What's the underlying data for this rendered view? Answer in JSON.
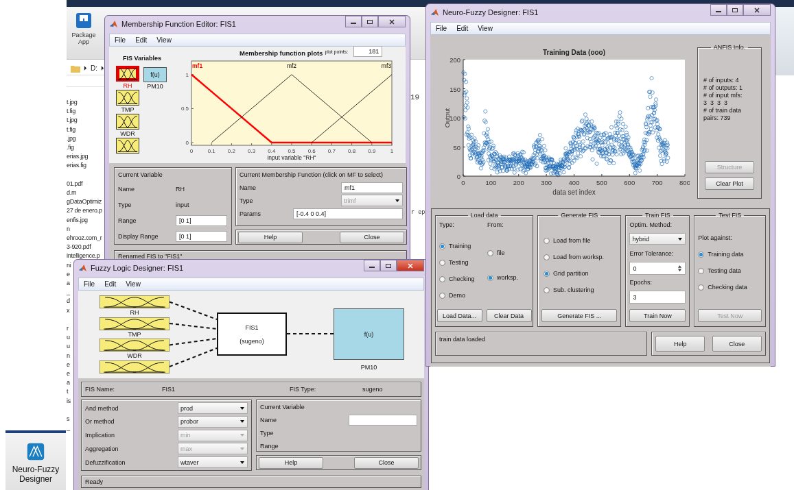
{
  "desktop": {
    "ribbon_button": "Package App",
    "path": "D:",
    "file_groups": [
      [
        "t.jpg",
        "t.fig",
        "t.jpg",
        "t.fig",
        ".jpg",
        ".fig",
        "erias.jpg",
        "erias.fig"
      ],
      [
        "01.pdf",
        "d.m",
        "gDataOptimiz",
        "27 de enero.p",
        "enfis.jpg",
        "n",
        "ehrooz.com_r",
        "3-920.pdf",
        "intelligence.p",
        "ni",
        "e",
        "a",
        "_",
        "d",
        "x"
      ],
      [
        "r",
        "u",
        "u",
        "n",
        "e",
        "e",
        "a",
        "t",
        "is"
      ],
      [
        "s",
        "_"
      ]
    ],
    "side_texts": [
      "19",
      "r ep"
    ],
    "app_button": "Neuro-Fuzzy Designer"
  },
  "mf_editor": {
    "title": "Membership Function Editor: FIS1",
    "menu": [
      "File",
      "Edit",
      "View"
    ],
    "variables_heading": "FIS Variables",
    "inputs": [
      {
        "kind": "labeled",
        "name": "RH",
        "selected": true
      },
      {
        "kind": "labeled",
        "name": "TMP",
        "selected": false
      },
      {
        "kind": "labeled",
        "name": "WDR",
        "selected": false
      },
      {
        "kind": "unlabeled",
        "selected": false
      }
    ],
    "output": {
      "symbol": "f(u)",
      "name": "PM10"
    },
    "plot_points_label": "plot points:",
    "plot_points": "181",
    "chart_data": {
      "type": "line",
      "title": "Membership function plots",
      "xlabel": "input variable \"RH\"",
      "x": [
        0,
        0.1,
        0.4,
        0.5,
        0.6,
        0.9,
        1
      ],
      "series": [
        {
          "name": "mf1",
          "color": "#ff0000",
          "values": [
            1,
            0.75,
            0,
            0,
            0,
            0,
            0
          ]
        },
        {
          "name": "mf2",
          "color": "#000000",
          "values": [
            null,
            0,
            0.75,
            1,
            0.75,
            0,
            null
          ]
        },
        {
          "name": "mf3",
          "color": "#000000",
          "values": [
            null,
            null,
            null,
            null,
            0,
            0.75,
            1
          ]
        }
      ],
      "xlim": [
        0,
        1
      ],
      "ylim": [
        -0.04,
        1.2
      ],
      "xticks": [
        0,
        0.1,
        0.2,
        0.3,
        0.4,
        0.5,
        0.6,
        0.7,
        0.8,
        0.9,
        1
      ],
      "yticks": [
        0,
        0.5,
        1
      ]
    },
    "current_variable": {
      "heading": "Current Variable",
      "rows": [
        {
          "label": "Name",
          "value": "RH",
          "kind": "text"
        },
        {
          "label": "Type",
          "value": "input",
          "kind": "text"
        },
        {
          "label": "Range",
          "value": "[0 1]",
          "kind": "field"
        },
        {
          "label": "Display Range",
          "value": "[0 1]",
          "kind": "field"
        }
      ]
    },
    "current_mf": {
      "heading": "Current Membership Function (click on MF to select)",
      "rows": [
        {
          "label": "Name",
          "value": "mf1",
          "kind": "field"
        },
        {
          "label": "Type",
          "value": "trimf",
          "kind": "dropdown"
        },
        {
          "label": "Params",
          "value": "[-0.4 0 0.4]",
          "kind": "wide_field"
        }
      ]
    },
    "buttons": [
      "Help",
      "Close"
    ],
    "status": "Renamed FIS to \"FIS1\""
  },
  "fl_designer": {
    "title": "Fuzzy Logic Designer: FIS1",
    "menu": [
      "File",
      "Edit",
      "View"
    ],
    "inputs": [
      {
        "kind": "labeled",
        "name": "RH"
      },
      {
        "kind": "labeled",
        "name": "TMP"
      },
      {
        "kind": "labeled",
        "name": "WDR"
      },
      {
        "kind": "unlabeled"
      }
    ],
    "system": {
      "name": "FIS1",
      "type": "(sugeno)"
    },
    "output": {
      "symbol": "f(u)",
      "name": "PM10"
    },
    "fis_name_label": "FIS Name:",
    "fis_name": "FIS1",
    "fis_type_label": "FIS Type:",
    "fis_type": "sugeno",
    "methods": [
      {
        "label": "And method",
        "value": "prod",
        "disabled": false
      },
      {
        "label": "Or method",
        "value": "probor",
        "disabled": false
      },
      {
        "label": "Implication",
        "value": "min",
        "disabled": true
      },
      {
        "label": "Aggregation",
        "value": "max",
        "disabled": true
      },
      {
        "label": "Defuzzification",
        "value": "wtaver",
        "disabled": false
      }
    ],
    "current_variable": {
      "heading": "Current Variable",
      "labels": [
        "Name",
        "Type",
        "Range"
      ]
    },
    "buttons": [
      "Help",
      "Close"
    ],
    "status": "Ready"
  },
  "nf_designer": {
    "title": "Neuro-Fuzzy Designer: FIS1",
    "menu": [
      "File",
      "Edit",
      "View"
    ],
    "plot": {
      "title": "Training Data (ooo)",
      "xlabel": "data set index",
      "ylabel": "Output",
      "xticks": [
        "0",
        "100",
        "200",
        "300",
        "400",
        "500",
        "600",
        "700",
        "800"
      ],
      "yticks": [
        "200",
        "150",
        "100",
        "50",
        "0"
      ]
    },
    "info": {
      "heading": "ANFIS Info.",
      "lines": [
        "# of inputs: 4",
        "# of outputs: 1",
        "# of input mfs:",
        "3  3  3  3",
        "# of train data",
        "pairs: 739"
      ],
      "buttons": [
        {
          "label": "Structure",
          "disabled": true
        },
        {
          "label": "Clear Plot",
          "disabled": false
        }
      ]
    },
    "load_data": {
      "heading": "Load data",
      "type_label": "Type:",
      "from_label": "From:",
      "types": [
        {
          "label": "Training",
          "selected": true
        },
        {
          "label": "Testing",
          "selected": false
        },
        {
          "label": "Checking",
          "selected": false
        },
        {
          "label": "Demo",
          "selected": false
        }
      ],
      "sources": [
        {
          "label": "file",
          "selected": false
        },
        {
          "label": "worksp.",
          "selected": true
        }
      ],
      "buttons": [
        "Load Data...",
        "Clear Data"
      ]
    },
    "generate": {
      "heading": "Generate FIS",
      "options": [
        {
          "label": "Load from file",
          "selected": false
        },
        {
          "label": "Load from worksp.",
          "selected": false
        },
        {
          "label": "Grid partition",
          "selected": true
        },
        {
          "label": "Sub. clustering",
          "selected": false
        }
      ],
      "button": "Generate FIS ..."
    },
    "train": {
      "heading": "Train FIS",
      "method_label": "Optim. Method:",
      "method": "hybrid",
      "tolerance_label": "Error Tolerance:",
      "tolerance": "0",
      "epochs_label": "Epochs:",
      "epochs": "3",
      "button": "Train Now"
    },
    "test": {
      "heading": "Test FIS",
      "plot_label": "Plot against:",
      "options": [
        {
          "label": "Training data",
          "selected": true
        },
        {
          "label": "Testing data",
          "selected": false
        },
        {
          "label": "Checking data",
          "selected": false
        }
      ],
      "button": {
        "label": "Test Now",
        "disabled": true
      }
    },
    "status": "train data loaded",
    "buttons": [
      "Help",
      "Close"
    ]
  }
}
